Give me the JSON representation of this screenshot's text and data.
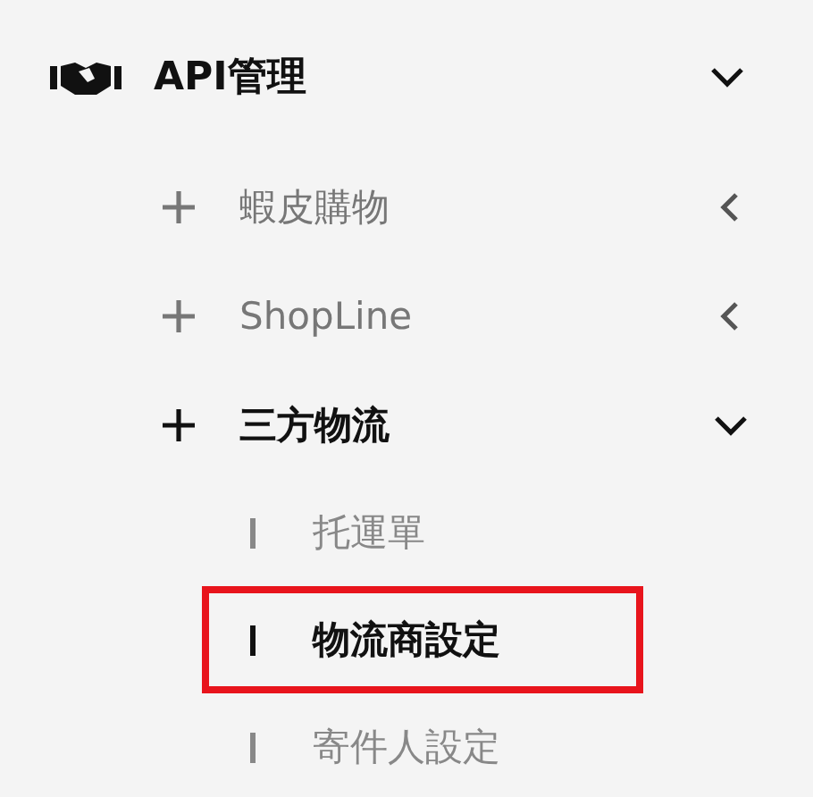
{
  "menu": {
    "label": "API管理",
    "expanded": true,
    "children": [
      {
        "label": "蝦皮購物",
        "expanded": false
      },
      {
        "label": "ShopLine",
        "expanded": false
      },
      {
        "label": "三方物流",
        "expanded": true,
        "children": [
          {
            "label": "托運單",
            "selected": false,
            "highlighted": false
          },
          {
            "label": "物流商設定",
            "selected": true,
            "highlighted": true
          },
          {
            "label": "寄件人設定",
            "selected": false,
            "highlighted": false
          }
        ]
      }
    ]
  }
}
